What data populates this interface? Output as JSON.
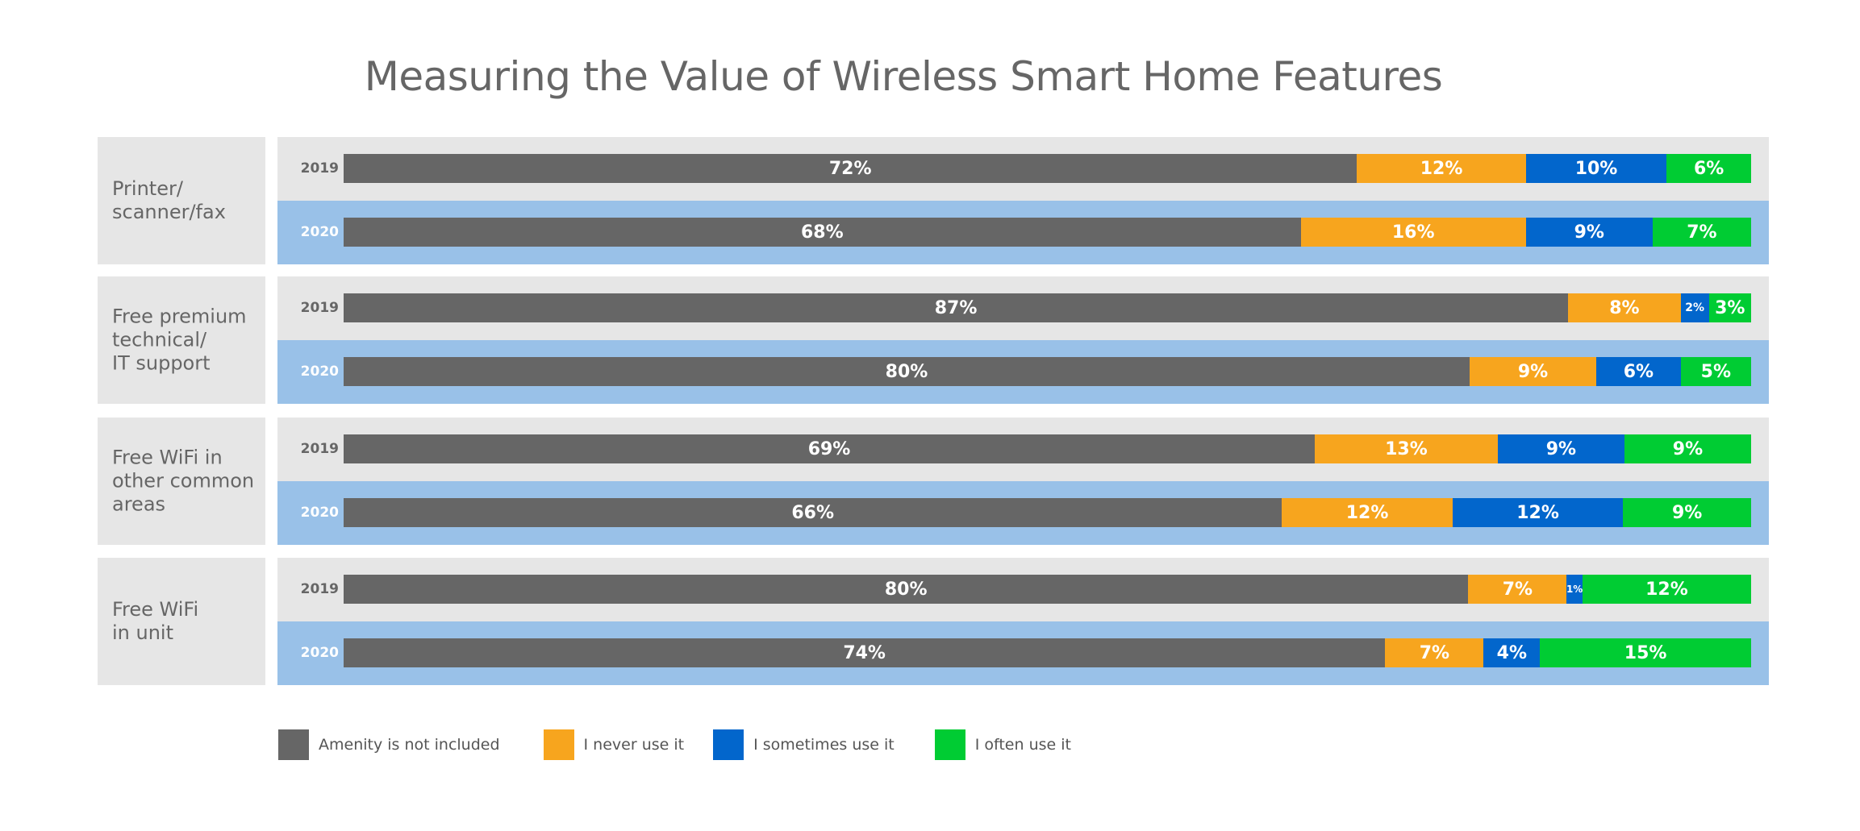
{
  "chart_data": {
    "type": "bar",
    "orientation": "horizontal",
    "stacked": true,
    "title": "Measuring the Value of Wireless Smart Home Features",
    "xlabel": "",
    "ylabel": "",
    "xlim": [
      0,
      100
    ],
    "grid": false,
    "legend_position": "bottom-left",
    "series_names": [
      "Amenity is not included",
      "I never use it",
      "I sometimes use it",
      "I often use it"
    ],
    "series_colors": [
      "#666666",
      "#f7a51e",
      "#0266cc",
      "#00cc33"
    ],
    "categories": [
      {
        "name": "Printer/\nscanner/fax",
        "years": [
          {
            "year": "2019",
            "values": [
              72,
              12,
              10,
              6
            ],
            "labels": [
              "72%",
              "12%",
              "10%",
              "6%"
            ]
          },
          {
            "year": "2020",
            "values": [
              68,
              16,
              9,
              7
            ],
            "labels": [
              "68%",
              "16%",
              "9%",
              "7%"
            ]
          }
        ]
      },
      {
        "name": "Free premium\ntechnical/\nIT support",
        "years": [
          {
            "year": "2019",
            "values": [
              87,
              8,
              2,
              3
            ],
            "labels": [
              "87%",
              "8%",
              "2%",
              "3%"
            ]
          },
          {
            "year": "2020",
            "values": [
              80,
              9,
              6,
              5
            ],
            "labels": [
              "80%",
              "9%",
              "6%",
              "5%"
            ]
          }
        ]
      },
      {
        "name": "Free WiFi in\nother common\nareas",
        "years": [
          {
            "year": "2019",
            "values": [
              69,
              13,
              9,
              9
            ],
            "labels": [
              "69%",
              "13%",
              "9%",
              "9%"
            ]
          },
          {
            "year": "2020",
            "values": [
              66,
              12,
              12,
              9
            ],
            "labels": [
              "66%",
              "12%",
              "12%",
              "9%"
            ]
          }
        ]
      },
      {
        "name": "Free WiFi\nin unit",
        "years": [
          {
            "year": "2019",
            "values": [
              80,
              7,
              1,
              12
            ],
            "labels": [
              "80%",
              "7%",
              "1%",
              "12%"
            ]
          },
          {
            "year": "2020",
            "values": [
              74,
              7,
              4,
              15
            ],
            "labels": [
              "74%",
              "7%",
              "4%",
              "15%"
            ]
          }
        ]
      }
    ]
  }
}
